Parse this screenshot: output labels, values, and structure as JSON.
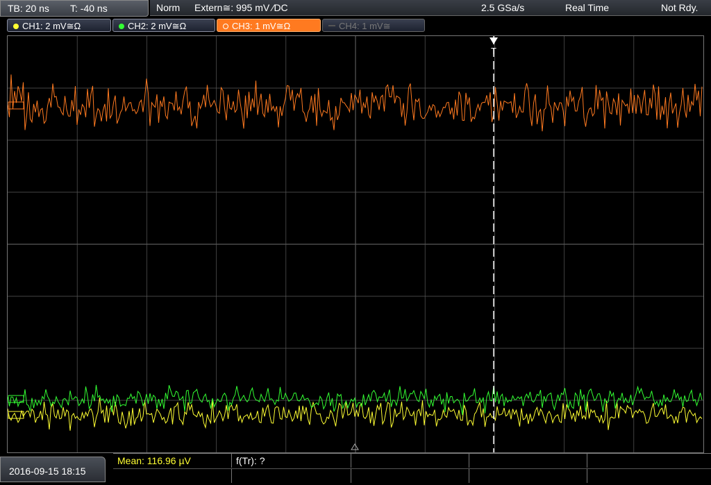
{
  "timebase": {
    "tb": "TB: 20 ns",
    "t": "T: -40 ns"
  },
  "status": {
    "mode": "Norm",
    "trigger": "Extern≅: 995 mV ⁄DC",
    "samplerate": "2.5 GSa/s",
    "acq": "Real Time",
    "state": "Not Rdy."
  },
  "channels": [
    {
      "label": "CH1: 2 mV≅Ω",
      "color": "#ffff33",
      "active": false,
      "enabled": true
    },
    {
      "label": "CH2: 2 mV≅Ω",
      "color": "#33ff33",
      "active": false,
      "enabled": true
    },
    {
      "label": "CH3: 1 mV≅Ω",
      "color": "#ff7a20",
      "active": true,
      "enabled": true
    },
    {
      "label": "CH4: 1 mV≅",
      "color": "#777777",
      "active": false,
      "enabled": false
    }
  ],
  "trigger_marker": "T",
  "datetime": "2016-09-15 18:15",
  "measurements": {
    "mean": "Mean: 116.96 µV",
    "freq": "f(Tr): ?"
  },
  "colors": {
    "ch1": "#ffff33",
    "ch2": "#33ff33",
    "ch3": "#ff7a20",
    "grid": "#5a5a5a"
  }
}
